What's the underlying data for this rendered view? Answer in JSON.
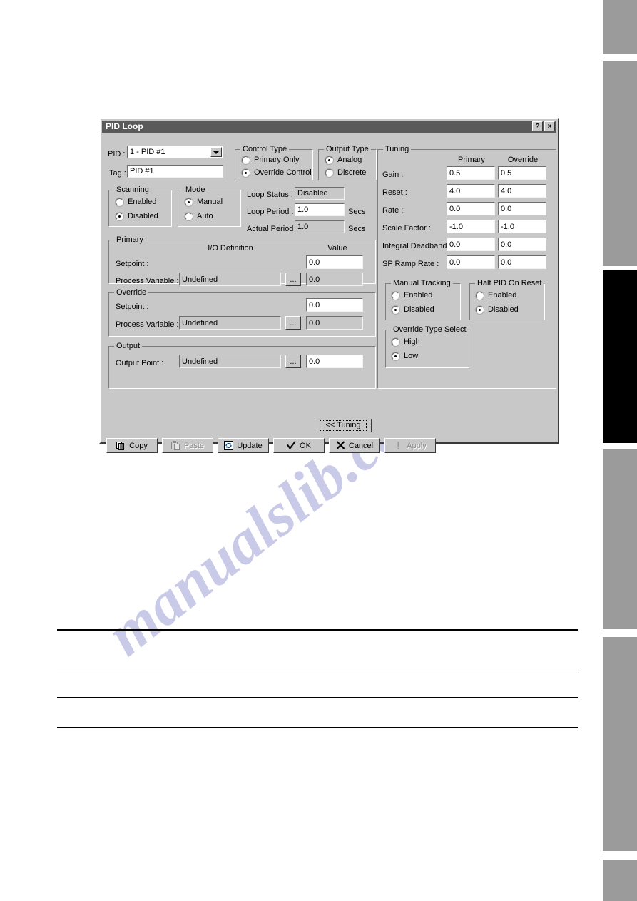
{
  "window": {
    "title": "PID Loop",
    "help_button": "?",
    "close_button": "×"
  },
  "top": {
    "pid_label": "PID :",
    "pid_value": "1 - PID #1",
    "tag_label": "Tag :",
    "tag_value": "PID #1"
  },
  "control_type": {
    "caption": "Control Type",
    "options": [
      "Primary Only",
      "Override Control"
    ],
    "selected": "Override Control"
  },
  "output_type": {
    "caption": "Output Type",
    "options": [
      "Analog",
      "Discrete"
    ],
    "selected": "Analog"
  },
  "scanning": {
    "caption": "Scanning",
    "options": [
      "Enabled",
      "Disabled"
    ],
    "selected": "Disabled"
  },
  "mode": {
    "caption": "Mode",
    "options": [
      "Manual",
      "Auto"
    ],
    "selected": "Manual"
  },
  "loop": {
    "status_label": "Loop Status :",
    "status_value": "Disabled",
    "period_label": "Loop Period :",
    "period_value": "1.0",
    "period_units": "Secs",
    "actual_label": "Actual Period :",
    "actual_value": "1.0",
    "actual_units": "Secs"
  },
  "primary": {
    "caption": "Primary",
    "io_header": "I/O Definition",
    "value_header": "Value",
    "setpoint_label": "Setpoint :",
    "setpoint_value": "0.0",
    "pv_label": "Process Variable :",
    "pv_io": "Undefined",
    "pv_browse": "...",
    "pv_value": "0.0"
  },
  "override": {
    "caption": "Override",
    "setpoint_label": "Setpoint :",
    "setpoint_value": "0.0",
    "pv_label": "Process Variable :",
    "pv_io": "Undefined",
    "pv_browse": "...",
    "pv_value": "0.0"
  },
  "output": {
    "caption": "Output",
    "point_label": "Output Point :",
    "point_io": "Undefined",
    "point_browse": "...",
    "point_value": "0.0"
  },
  "tuning": {
    "caption": "Tuning",
    "col_primary": "Primary",
    "col_override": "Override",
    "rows": [
      {
        "label": "Gain :",
        "primary": "0.5",
        "override": "0.5"
      },
      {
        "label": "Reset :",
        "primary": "4.0",
        "override": "4.0"
      },
      {
        "label": "Rate :",
        "primary": "0.0",
        "override": "0.0"
      },
      {
        "label": "Scale Factor :",
        "primary": "-1.0",
        "override": "-1.0"
      },
      {
        "label": "Integral Deadband :",
        "primary": "0.0",
        "override": "0.0"
      },
      {
        "label": "SP Ramp Rate :",
        "primary": "0.0",
        "override": "0.0"
      }
    ]
  },
  "manual_tracking": {
    "caption": "Manual Tracking",
    "options": [
      "Enabled",
      "Disabled"
    ],
    "selected": "Disabled"
  },
  "halt_pid": {
    "caption": "Halt PID On Reset",
    "options": [
      "Enabled",
      "Disabled"
    ],
    "selected": "Disabled"
  },
  "override_type": {
    "caption": "Override Type Select",
    "options": [
      "High",
      "Low"
    ],
    "selected": "Low"
  },
  "buttons": {
    "tuning": "<< Tuning",
    "copy": "Copy",
    "paste": "Paste",
    "update": "Update",
    "ok": "OK",
    "cancel": "Cancel",
    "apply": "Apply"
  },
  "watermark": {
    "text_main": "manualslib.com",
    "text_upper": "slib.com"
  },
  "colors": {
    "dialog_face": "#c8c8c8",
    "titlebar": "#5a5a5a",
    "page_tab": "#9b9b9b",
    "page_tab_active": "#000000",
    "watermark": "#c9c9e8"
  }
}
